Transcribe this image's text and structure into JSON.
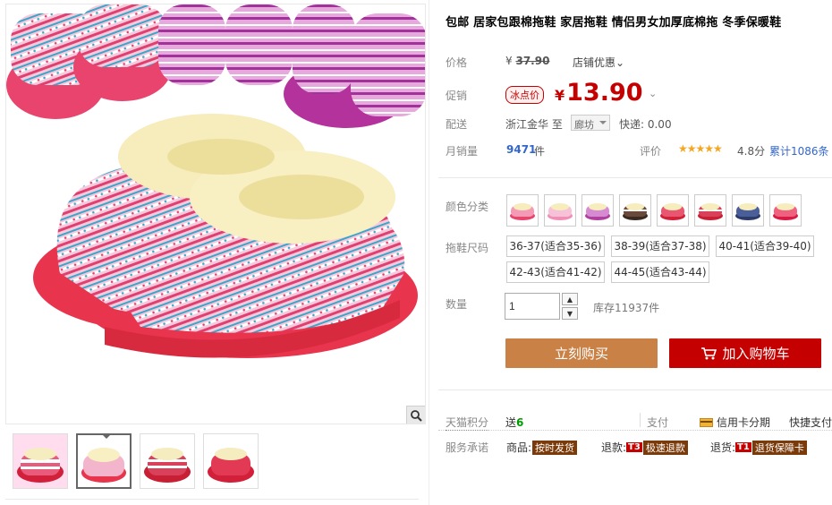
{
  "product": {
    "title": "包邮 居家包跟棉拖鞋 家居拖鞋 情侣男女加厚底棉拖 冬季保暖鞋"
  },
  "price": {
    "label": "价格",
    "currency": "¥",
    "original": "37.90",
    "shop_promo_link": "店铺优惠"
  },
  "promo": {
    "label": "促销",
    "tag": "冰点价",
    "currency": "¥",
    "price": "13.90"
  },
  "shipping": {
    "label": "配送",
    "from": "浙江金华",
    "to_word": "至",
    "destination": "廊坊",
    "fee": "快递: 0.00"
  },
  "sales": {
    "label": "月销量",
    "count": "9471",
    "unit": "件",
    "review_label": "评价",
    "stars": "★★★★★",
    "score": "4.8分",
    "review_count": "累计1086条"
  },
  "color": {
    "label": "颜色分类",
    "options": [
      "pink-stripe",
      "pink-dot",
      "purple",
      "black-stripe",
      "red-heart",
      "red-stripe",
      "navy",
      "red-pink"
    ]
  },
  "size": {
    "label": "拖鞋尺码",
    "options": [
      "36-37(适合35-36)",
      "38-39(适合37-38)",
      "40-41(适合39-40)",
      "42-43(适合41-42)",
      "44-45(适合43-44)"
    ]
  },
  "quantity": {
    "label": "数量",
    "value": "1",
    "stock": "库存11937件"
  },
  "actions": {
    "buy_now": "立刻购买",
    "add_to_cart": "加入购物车"
  },
  "footer": {
    "points_label": "天猫积分",
    "points_prefix": "送",
    "points_value": "6",
    "pay_label": "支付",
    "credit_installment": "信用卡分期",
    "quick_pay": "快捷支付",
    "service_label": "服务承诺",
    "goods_label": "商品:",
    "goods_badge": "按时发货",
    "refund_label": "退款:",
    "refund_t": "T3",
    "refund_badge": "极速退款",
    "return_label": "退货:",
    "return_t": "T1",
    "return_badge": "退货保障卡"
  },
  "colors": {
    "accent_red": "#c40000",
    "buy_orange": "#c98146",
    "link_blue": "#3366cc"
  }
}
